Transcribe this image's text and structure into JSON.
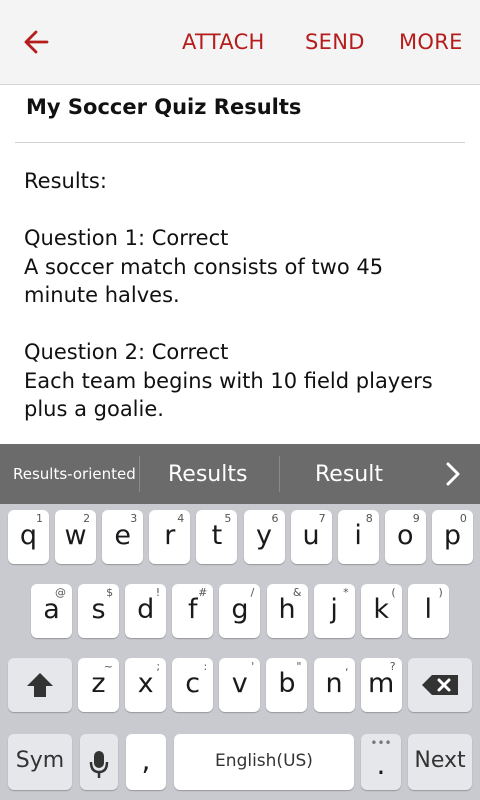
{
  "header": {
    "back_icon": "arrow-left-icon",
    "actions": [
      "ATTACH",
      "SEND",
      "MORE"
    ],
    "accent_color": "#b51c1c"
  },
  "message": {
    "subject": "My Soccer Quiz Results",
    "lines": [
      "Results:",
      "",
      "Question 1: Correct",
      "A soccer match consists of two 45",
      "minute halves.",
      "",
      "Question 2: Correct",
      "Each team begins with 10 field players",
      "plus a goalie."
    ]
  },
  "suggestions": {
    "items": [
      "Results-oriented",
      "Results",
      "Result"
    ],
    "more_icon": "chevron-right-icon"
  },
  "keyboard": {
    "row1": [
      {
        "key": "q",
        "hint": "1"
      },
      {
        "key": "w",
        "hint": "2"
      },
      {
        "key": "e",
        "hint": "3"
      },
      {
        "key": "r",
        "hint": "4"
      },
      {
        "key": "t",
        "hint": "5"
      },
      {
        "key": "y",
        "hint": "6"
      },
      {
        "key": "u",
        "hint": "7"
      },
      {
        "key": "i",
        "hint": "8"
      },
      {
        "key": "o",
        "hint": "9"
      },
      {
        "key": "p",
        "hint": "0"
      }
    ],
    "row2": [
      {
        "key": "a",
        "hint": "@"
      },
      {
        "key": "s",
        "hint": "$"
      },
      {
        "key": "d",
        "hint": "!"
      },
      {
        "key": "f",
        "hint": "#"
      },
      {
        "key": "g",
        "hint": "/"
      },
      {
        "key": "h",
        "hint": "&"
      },
      {
        "key": "j",
        "hint": "*"
      },
      {
        "key": "k",
        "hint": "("
      },
      {
        "key": "l",
        "hint": ")"
      }
    ],
    "row3": [
      {
        "key": "z",
        "hint": "~"
      },
      {
        "key": "x",
        "hint": ";"
      },
      {
        "key": "c",
        "hint": ":"
      },
      {
        "key": "v",
        "hint": "'"
      },
      {
        "key": "b",
        "hint": "\""
      },
      {
        "key": "n",
        "hint": ","
      },
      {
        "key": "m",
        "hint": "?"
      }
    ],
    "shift_icon": "shift-arrow-icon",
    "backspace_icon": "backspace-icon",
    "sym_label": "Sym",
    "mic_icon": "microphone-icon",
    "comma_label": ",",
    "space_label": "English(US)",
    "period_label": ".",
    "period_hint": "•••",
    "next_label": "Next"
  }
}
